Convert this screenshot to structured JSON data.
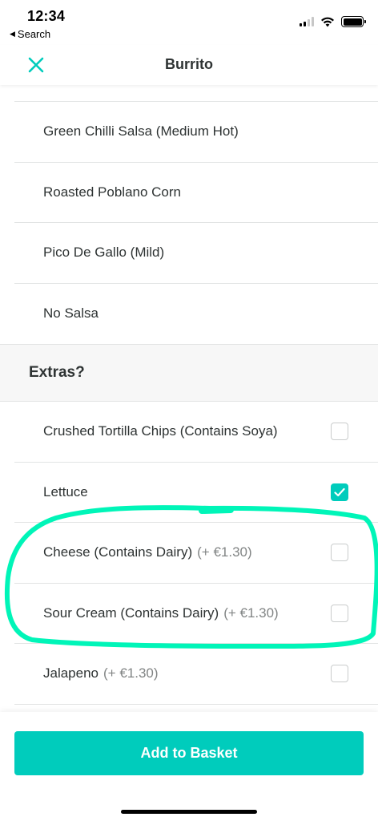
{
  "status_bar": {
    "time": "12:34",
    "back_app": "Search",
    "back_icon": "back-triangle-icon"
  },
  "header": {
    "title": "Burrito",
    "close_icon": "close-icon"
  },
  "salsa_options": [
    {
      "label": "Green Chilli Salsa (Medium Hot)"
    },
    {
      "label": "Roasted Poblano Corn"
    },
    {
      "label": "Pico De Gallo (Mild)"
    },
    {
      "label": "No Salsa"
    }
  ],
  "extras": {
    "title": "Extras?",
    "items": [
      {
        "label": "Crushed Tortilla Chips (Contains Soya)",
        "price": "",
        "checked": false
      },
      {
        "label": "Lettuce",
        "price": "",
        "checked": true
      },
      {
        "label": "Cheese (Contains Dairy)",
        "price": "(+ €1.30)",
        "checked": false
      },
      {
        "label": "Sour Cream (Contains Dairy)",
        "price": "(+ €1.30)",
        "checked": false
      },
      {
        "label": "Jalapeno",
        "price": "(+ €1.30)",
        "checked": false
      }
    ]
  },
  "footer": {
    "add_button": "Add to Basket"
  },
  "colors": {
    "accent": "#00ccbc",
    "annotation": "#00f5b8",
    "text": "#2e3333",
    "muted": "#828585"
  }
}
